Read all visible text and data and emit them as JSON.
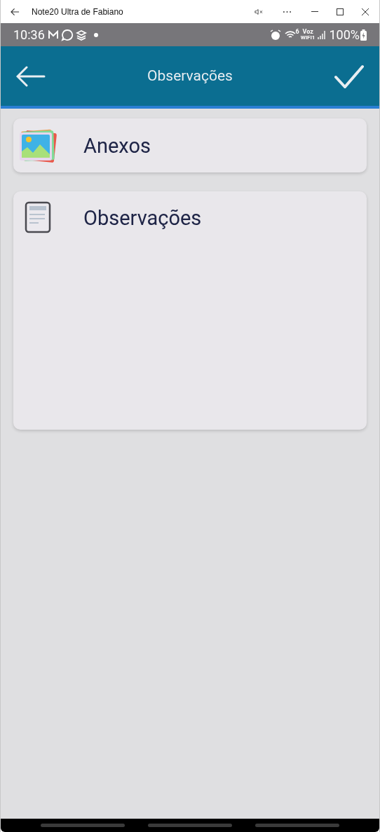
{
  "window": {
    "title": "Note20 Ultra de Fabiano"
  },
  "status_bar": {
    "time": "10:36",
    "wifi_badge": "6",
    "voz_top": "Voz",
    "voz_bottom": "WIFI1",
    "battery": "100%"
  },
  "app_bar": {
    "title": "Observações"
  },
  "cards": [
    {
      "kind": "attachments",
      "label": "Anexos"
    },
    {
      "kind": "notes",
      "label": "Observações"
    }
  ]
}
